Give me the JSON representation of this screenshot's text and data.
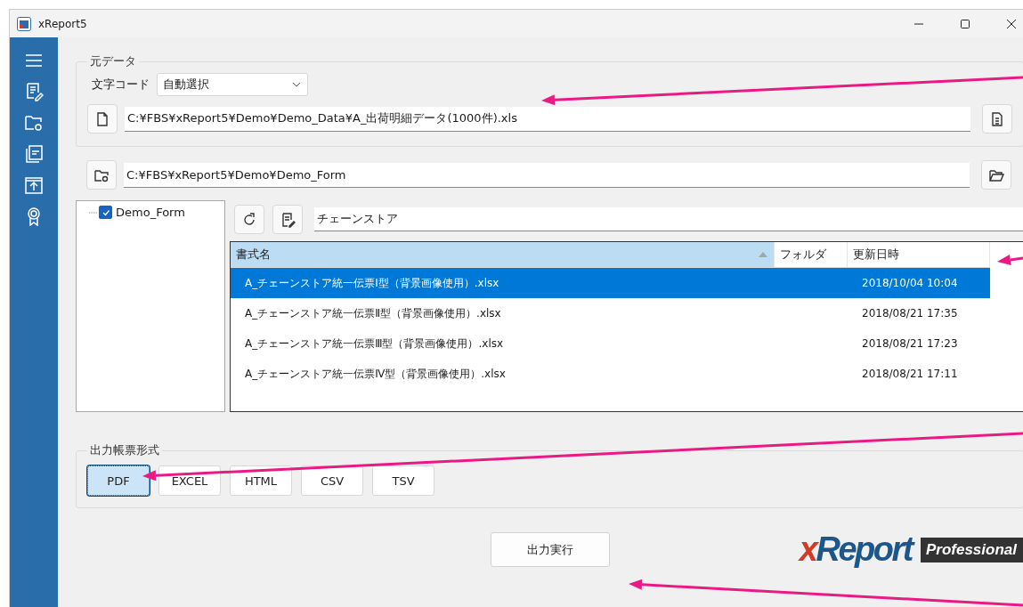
{
  "window": {
    "title": "xReport5"
  },
  "source_data": {
    "title": "元データ",
    "encoding_label": "文字コード",
    "encoding": "自動選択",
    "file_path": "C:¥FBS¥xReport5¥Demo¥Demo_Data¥A_出荷明細データ(1000件).xls"
  },
  "form_folder": {
    "path": "C:¥FBS¥xReport5¥Demo¥Demo_Form"
  },
  "folder_tree": [
    {
      "label": "Demo_Form",
      "checked": true
    }
  ],
  "filter": {
    "value": "チェーンストア"
  },
  "table": {
    "columns": [
      {
        "label": "書式名",
        "sorted": true
      },
      {
        "label": "フォルダ",
        "sorted": false
      },
      {
        "label": "更新日時",
        "sorted": false
      }
    ],
    "rows": [
      {
        "name": "A_チェーンストア統一伝票Ⅰ型（背景画像使用）.xlsx",
        "modified": "2018/10/04 10:04",
        "selected": true
      },
      {
        "name": "A_チェーンストア統一伝票Ⅱ型（背景画像使用）.xlsx",
        "modified": "2018/08/21 17:35",
        "selected": false
      },
      {
        "name": "A_チェーンストア統一伝票Ⅲ型（背景画像使用）.xlsx",
        "modified": "2018/08/21 17:23",
        "selected": false
      },
      {
        "name": "A_チェーンストア統一伝票Ⅳ型（背景画像使用）.xlsx",
        "modified": "2018/08/21 17:11",
        "selected": false
      }
    ]
  },
  "output_format": {
    "title": "出力帳票形式",
    "options": [
      {
        "label": "PDF",
        "selected": true
      },
      {
        "label": "EXCEL",
        "selected": false
      },
      {
        "label": "HTML",
        "selected": false
      },
      {
        "label": "CSV",
        "selected": false
      },
      {
        "label": "TSV",
        "selected": false
      }
    ]
  },
  "execute_button": "出力実行",
  "logo": {
    "name": "xReport",
    "edition": "Professional"
  }
}
